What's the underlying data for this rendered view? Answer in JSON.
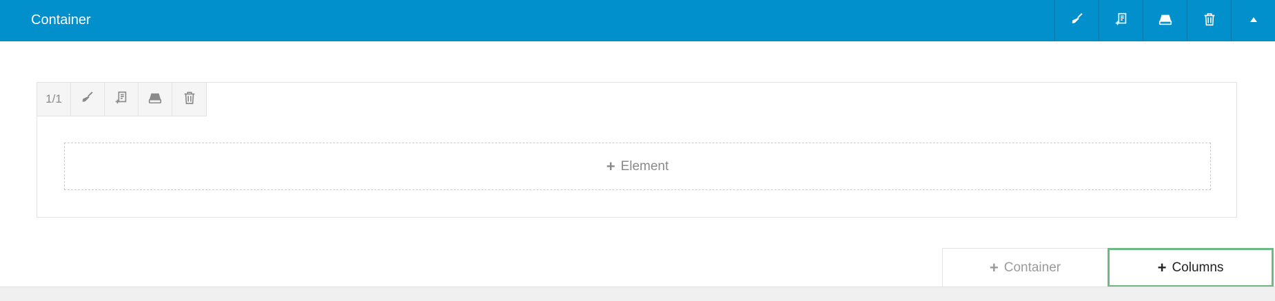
{
  "header": {
    "title": "Container",
    "bg_color": "#0290cc",
    "actions": [
      {
        "name": "edit",
        "icon": "brush-icon"
      },
      {
        "name": "duplicate",
        "icon": "duplicate-icon"
      },
      {
        "name": "save",
        "icon": "drive-icon"
      },
      {
        "name": "delete",
        "icon": "trash-icon"
      },
      {
        "name": "collapse",
        "icon": "triangle-up-icon"
      }
    ]
  },
  "column": {
    "size_label": "1/1",
    "tools": [
      "brush-icon",
      "duplicate-icon",
      "drive-icon",
      "trash-icon"
    ],
    "add_element": {
      "plus": "+",
      "label": "Element"
    }
  },
  "bottom": {
    "add_container": {
      "plus": "+",
      "label": "Container"
    },
    "add_columns": {
      "plus": "+",
      "label": "Columns"
    },
    "highlight_color": "#6cb982"
  }
}
